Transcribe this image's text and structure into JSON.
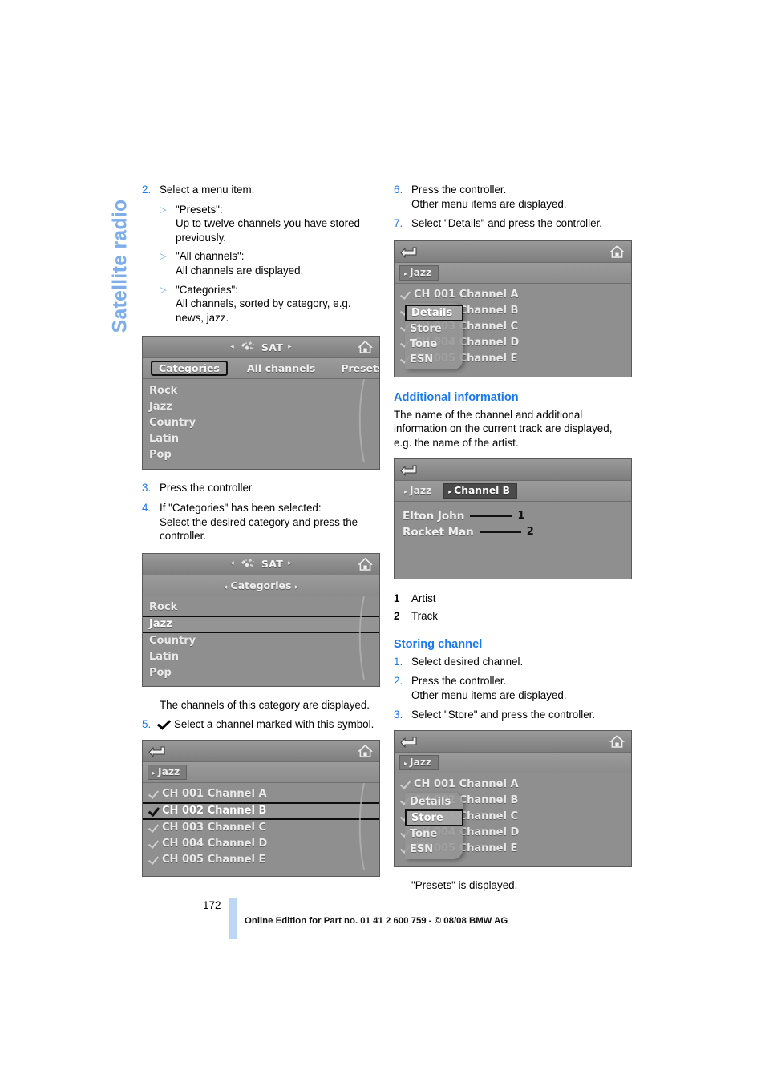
{
  "chapter": {
    "title": "Satellite radio"
  },
  "colors": {
    "accent_blue": "#1a7aed",
    "tab_blue": "#7fadea",
    "footer_bar": "#bcd6f5"
  },
  "left_column": {
    "step2": {
      "num": "2.",
      "text": "Select a menu item:"
    },
    "bullets": [
      {
        "title": "\"Presets\":",
        "desc": "Up to twelve channels you have stored previously."
      },
      {
        "title": "\"All channels\":",
        "desc": "All channels are displayed."
      },
      {
        "title": "\"Categories\":",
        "desc": "All channels, sorted by category, e.g. news, jazz."
      }
    ],
    "step3": {
      "num": "3.",
      "text": "Press the controller."
    },
    "step4": {
      "num": "4.",
      "line1": "If \"Categories\" has been selected:",
      "line2": "Select the desired category and press the controller."
    },
    "note_channels": "The channels of this category are displayed.",
    "step5": {
      "num": "5.",
      "text": "Select a channel marked with this symbol."
    }
  },
  "right_column": {
    "step6": {
      "num": "6.",
      "line1": "Press the controller.",
      "line2": "Other menu items are displayed."
    },
    "step7": {
      "num": "7.",
      "text": "Select \"Details\" and press the controller."
    },
    "additional_information": {
      "heading": "Additional information",
      "body": "The name of the channel and additional information on the current track are displayed, e.g. the name of the artist."
    },
    "legend": [
      {
        "num": "1",
        "label": "Artist"
      },
      {
        "num": "2",
        "label": "Track"
      }
    ],
    "storing_channel": {
      "heading": "Storing channel",
      "steps": [
        {
          "num": "1.",
          "line1": "Select desired channel.",
          "line2": ""
        },
        {
          "num": "2.",
          "line1": "Press the controller.",
          "line2": "Other menu items are displayed."
        },
        {
          "num": "3.",
          "line1": "Select \"Store\" and press the controller.",
          "line2": ""
        }
      ]
    },
    "presets_note": "\"Presets\" is displayed."
  },
  "screens": {
    "sat_categories": {
      "title": "SAT",
      "tabs": [
        {
          "label": "Categories",
          "selected": true
        },
        {
          "label": "All channels",
          "selected": false
        },
        {
          "label": "Presets",
          "selected": false
        }
      ],
      "list": [
        "Rock",
        "Jazz",
        "Country",
        "Latin",
        "Pop"
      ]
    },
    "sat_category_select": {
      "title": "SAT",
      "crumb": "Categories",
      "list": [
        {
          "label": "Rock",
          "highlighted": false
        },
        {
          "label": "Jazz",
          "highlighted": true
        },
        {
          "label": "Country",
          "highlighted": false
        },
        {
          "label": "Latin",
          "highlighted": false
        },
        {
          "label": "Pop",
          "highlighted": false
        }
      ]
    },
    "jazz_channels": {
      "crumb": "Jazz",
      "list": [
        {
          "label": "CH 001 Channel A",
          "checked": true,
          "highlighted": false
        },
        {
          "label": "CH 002 Channel B",
          "checked": true,
          "highlighted": true
        },
        {
          "label": "CH 003 Channel C",
          "checked": true,
          "highlighted": false
        },
        {
          "label": "CH 004 Channel D",
          "checked": true,
          "highlighted": false
        },
        {
          "label": "CH 005 Channel E",
          "checked": true,
          "highlighted": false
        }
      ]
    },
    "jazz_menu_details": {
      "crumb": "Jazz",
      "list": [
        {
          "label": "CH 001 Channel A",
          "checked": true
        },
        {
          "label": "CH 002 Channel B",
          "checked": true
        },
        {
          "label": "CH 003 Channel C",
          "checked": true
        },
        {
          "label": "CH 004 Channel D",
          "checked": true
        },
        {
          "label": "CH 005 Channel E",
          "checked": true
        }
      ],
      "popup": [
        {
          "label": "Details",
          "selected": true
        },
        {
          "label": "Store",
          "selected": false
        },
        {
          "label": "Tone",
          "selected": false
        },
        {
          "label": "ESN",
          "selected": false
        }
      ]
    },
    "jazz_menu_store": {
      "crumb": "Jazz",
      "list": [
        {
          "label": "CH 001 Channel A",
          "checked": true
        },
        {
          "label": "CH 002 Channel B",
          "checked": true
        },
        {
          "label": "CH 003 Channel C",
          "checked": true
        },
        {
          "label": "CH 004 Channel D",
          "checked": true
        },
        {
          "label": "CH 005 Channel E",
          "checked": true
        }
      ],
      "popup": [
        {
          "label": "Details",
          "selected": false
        },
        {
          "label": "Store",
          "selected": true
        },
        {
          "label": "Tone",
          "selected": false
        },
        {
          "label": "ESN",
          "selected": false
        }
      ]
    },
    "channel_details": {
      "crumb_parent": "Jazz",
      "crumb_current": "Channel B",
      "artist": "Elton John",
      "track": "Rocket Man",
      "artist_index": "1",
      "track_index": "2"
    }
  },
  "footer": {
    "page_number": "172",
    "text": "Online Edition for Part no. 01 41 2 600 759 - © 08/08 BMW AG"
  }
}
